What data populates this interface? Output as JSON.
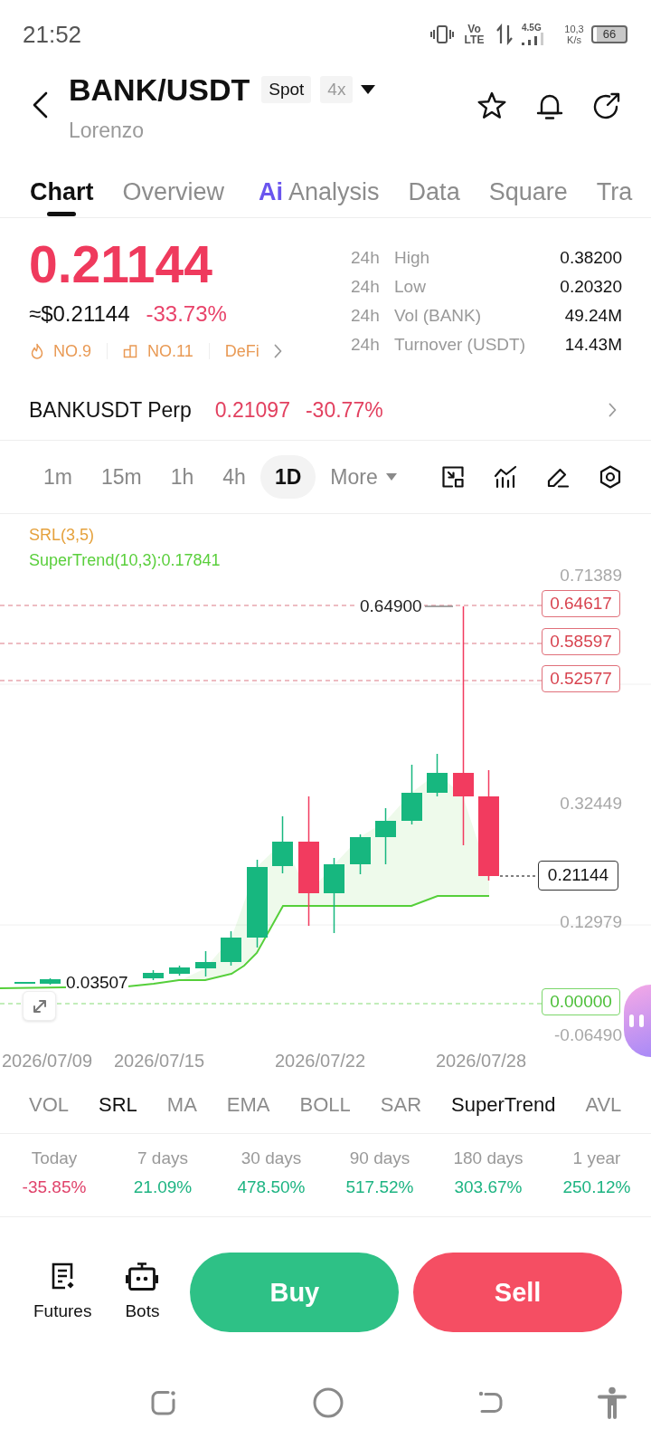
{
  "status_bar": {
    "time": "21:52",
    "network": "Vo LTE",
    "signal_label": "4.5G",
    "speed": "10,3 K/s",
    "battery": "66"
  },
  "header": {
    "title": "BANK/USDT",
    "badges": [
      {
        "label": "Spot",
        "kind": "market"
      },
      {
        "label": "4x",
        "kind": "leverage"
      }
    ],
    "subtitle": "Lorenzo"
  },
  "tabs": [
    {
      "label": "Chart",
      "selected": true
    },
    {
      "label": "Overview",
      "selected": false
    },
    {
      "badge": "Ai",
      "label": "Analysis",
      "selected": false
    },
    {
      "label": "Data",
      "selected": false
    },
    {
      "label": "Square",
      "selected": false
    },
    {
      "label": "Tra",
      "selected": false
    }
  ],
  "price": {
    "last": "0.21144",
    "usd": "≈$0.21144",
    "change": "-33.73%",
    "tags": [
      {
        "kind": "hot",
        "label": "NO.9"
      },
      {
        "kind": "rank",
        "label": "NO.11"
      },
      {
        "kind": "sector",
        "label": "DeFi"
      }
    ]
  },
  "stats": [
    {
      "period": "24h",
      "label": "High",
      "value": "0.38200"
    },
    {
      "period": "24h",
      "label": "Low",
      "value": "0.20320"
    },
    {
      "period": "24h",
      "label": "Vol (BANK)",
      "value": "49.24M"
    },
    {
      "period": "24h",
      "label": "Turnover (USDT)",
      "value": "14.43M"
    }
  ],
  "perp": {
    "name": "BANKUSDT Perp",
    "price": "0.21097",
    "change": "-30.77%"
  },
  "timeframes": [
    {
      "label": "1m",
      "kind": "interval",
      "selected": false
    },
    {
      "label": "15m",
      "kind": "interval",
      "selected": false
    },
    {
      "label": "1h",
      "kind": "interval",
      "selected": false
    },
    {
      "label": "4h",
      "kind": "interval",
      "selected": false
    },
    {
      "label": "1D",
      "kind": "interval",
      "selected": true
    },
    {
      "label": "More",
      "kind": "dropdown",
      "selected": false
    }
  ],
  "chart": {
    "legend": [
      {
        "label": "SRL(3,5)",
        "color": "#e5a13c"
      },
      {
        "label": "SuperTrend(10,3):0.17841",
        "color": "#5acf3c"
      }
    ],
    "y_axis": [
      "0.71389",
      "0.32449",
      "0.12979",
      "-0.06490"
    ],
    "levels": [
      {
        "label": "0.64617",
        "kind": "resistance"
      },
      {
        "label": "0.58597",
        "kind": "resistance"
      },
      {
        "label": "0.52577",
        "kind": "resistance"
      },
      {
        "label": "0.00000",
        "kind": "support"
      }
    ],
    "high_marker": "0.64900",
    "low_marker": "0.03507",
    "last_price": "0.21144",
    "x_axis": [
      "2026/07/09",
      "2026/07/15",
      "2026/07/22",
      "2026/07/28"
    ]
  },
  "indicators": [
    {
      "label": "VOL",
      "selected": false
    },
    {
      "label": "SRL",
      "selected": true
    },
    {
      "label": "MA",
      "selected": false
    },
    {
      "label": "EMA",
      "selected": false
    },
    {
      "label": "BOLL",
      "selected": false
    },
    {
      "label": "SAR",
      "selected": false
    },
    {
      "label": "SuperTrend",
      "selected": true
    },
    {
      "label": "AVL",
      "selected": false
    }
  ],
  "performance": [
    {
      "period": "Today",
      "value": "-35.85%",
      "color": "#e0436b"
    },
    {
      "period": "7 days",
      "value": "21.09%",
      "color": "#1db482"
    },
    {
      "period": "30 days",
      "value": "478.50%",
      "color": "#1db482"
    },
    {
      "period": "90 days",
      "value": "517.52%",
      "color": "#1db482"
    },
    {
      "period": "180 days",
      "value": "303.67%",
      "color": "#1db482"
    },
    {
      "period": "1 year",
      "value": "250.12%",
      "color": "#1db482"
    }
  ],
  "actions": {
    "shortcuts": [
      {
        "label": "Futures",
        "kind": "futures"
      },
      {
        "label": "Bots",
        "kind": "bots"
      }
    ],
    "buy": "Buy",
    "sell": "Sell"
  }
}
